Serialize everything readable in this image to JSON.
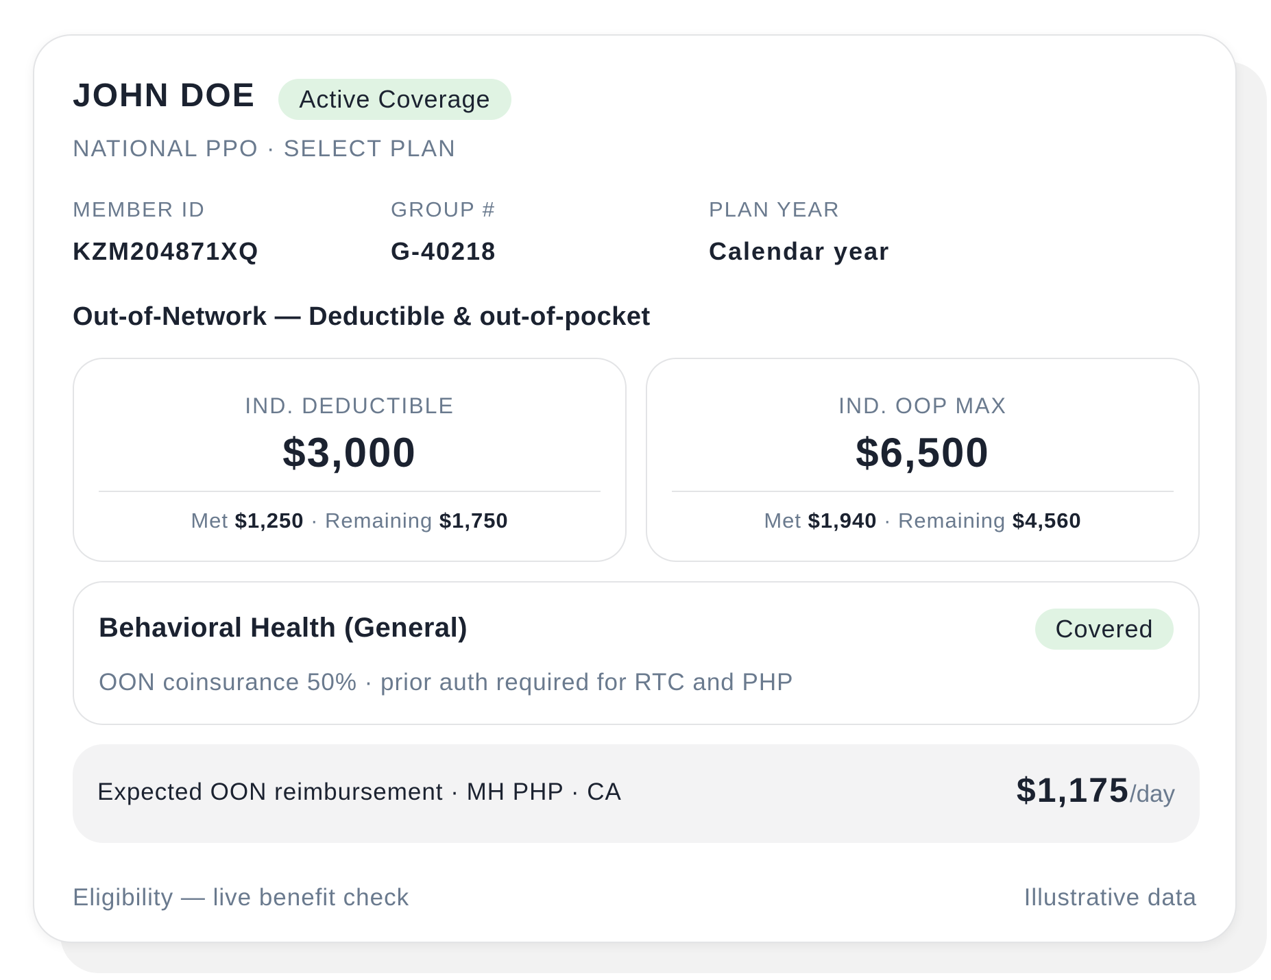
{
  "member": {
    "name": "JOHN DOE",
    "status": "Active Coverage",
    "plan": "NATIONAL PPO · SELECT PLAN"
  },
  "fields": [
    {
      "label": "MEMBER ID",
      "value": "KZM204871XQ"
    },
    {
      "label": "GROUP #",
      "value": "G-40218"
    },
    {
      "label": "PLAN YEAR",
      "value": "Calendar year"
    }
  ],
  "section_title": "Out-of-Network — Deductible & out-of-pocket",
  "stats": [
    {
      "label": "IND. DEDUCTIBLE",
      "value": "$3,000",
      "met_label": "Met",
      "met_value": "$1,250",
      "separator": "·",
      "remaining_label": "Remaining",
      "remaining_value": "$1,750"
    },
    {
      "label": "IND. OOP MAX",
      "value": "$6,500",
      "met_label": "Met",
      "met_value": "$1,940",
      "separator": "·",
      "remaining_label": "Remaining",
      "remaining_value": "$4,560"
    }
  ],
  "benefit": {
    "title": "Behavioral Health (General)",
    "status": "Covered",
    "description": "OON coinsurance 50% · prior auth required for RTC and PHP"
  },
  "reimbursement": {
    "label": "Expected OON reimbursement · MH PHP · CA",
    "amount": "$1,175",
    "unit": "/day"
  },
  "footer": {
    "left": "Eligibility — live benefit check",
    "right": "Illustrative data"
  },
  "colors": {
    "accent_green_bg": "#e0f3e3",
    "muted_text": "#6a7a8e",
    "primary_text": "#1b2230",
    "border": "#e3e4e6",
    "panel_bg": "#f3f3f4"
  }
}
